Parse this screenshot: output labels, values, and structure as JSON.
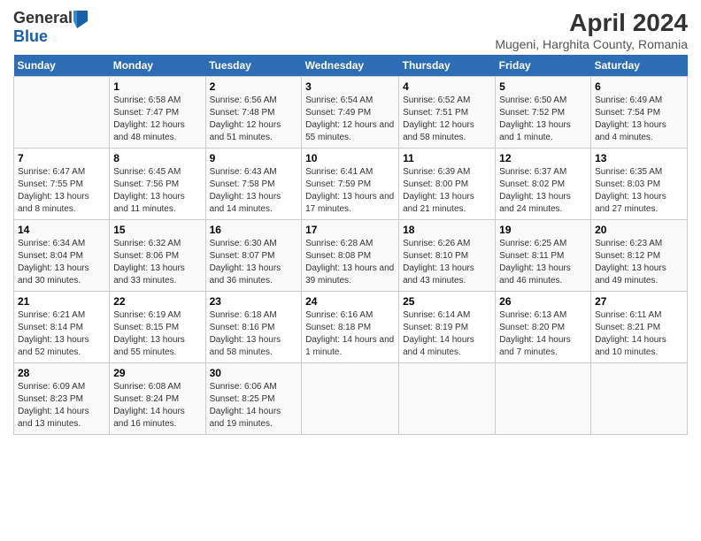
{
  "header": {
    "logo_general": "General",
    "logo_blue": "Blue",
    "title": "April 2024",
    "subtitle": "Mugeni, Harghita County, Romania"
  },
  "days_of_week": [
    "Sunday",
    "Monday",
    "Tuesday",
    "Wednesday",
    "Thursday",
    "Friday",
    "Saturday"
  ],
  "weeks": [
    [
      {
        "day": "",
        "info": ""
      },
      {
        "day": "1",
        "info": "Sunrise: 6:58 AM\nSunset: 7:47 PM\nDaylight: 12 hours\nand 48 minutes."
      },
      {
        "day": "2",
        "info": "Sunrise: 6:56 AM\nSunset: 7:48 PM\nDaylight: 12 hours\nand 51 minutes."
      },
      {
        "day": "3",
        "info": "Sunrise: 6:54 AM\nSunset: 7:49 PM\nDaylight: 12 hours\nand 55 minutes."
      },
      {
        "day": "4",
        "info": "Sunrise: 6:52 AM\nSunset: 7:51 PM\nDaylight: 12 hours\nand 58 minutes."
      },
      {
        "day": "5",
        "info": "Sunrise: 6:50 AM\nSunset: 7:52 PM\nDaylight: 13 hours\nand 1 minute."
      },
      {
        "day": "6",
        "info": "Sunrise: 6:49 AM\nSunset: 7:54 PM\nDaylight: 13 hours\nand 4 minutes."
      }
    ],
    [
      {
        "day": "7",
        "info": "Sunrise: 6:47 AM\nSunset: 7:55 PM\nDaylight: 13 hours\nand 8 minutes."
      },
      {
        "day": "8",
        "info": "Sunrise: 6:45 AM\nSunset: 7:56 PM\nDaylight: 13 hours\nand 11 minutes."
      },
      {
        "day": "9",
        "info": "Sunrise: 6:43 AM\nSunset: 7:58 PM\nDaylight: 13 hours\nand 14 minutes."
      },
      {
        "day": "10",
        "info": "Sunrise: 6:41 AM\nSunset: 7:59 PM\nDaylight: 13 hours\nand 17 minutes."
      },
      {
        "day": "11",
        "info": "Sunrise: 6:39 AM\nSunset: 8:00 PM\nDaylight: 13 hours\nand 21 minutes."
      },
      {
        "day": "12",
        "info": "Sunrise: 6:37 AM\nSunset: 8:02 PM\nDaylight: 13 hours\nand 24 minutes."
      },
      {
        "day": "13",
        "info": "Sunrise: 6:35 AM\nSunset: 8:03 PM\nDaylight: 13 hours\nand 27 minutes."
      }
    ],
    [
      {
        "day": "14",
        "info": "Sunrise: 6:34 AM\nSunset: 8:04 PM\nDaylight: 13 hours\nand 30 minutes."
      },
      {
        "day": "15",
        "info": "Sunrise: 6:32 AM\nSunset: 8:06 PM\nDaylight: 13 hours\nand 33 minutes."
      },
      {
        "day": "16",
        "info": "Sunrise: 6:30 AM\nSunset: 8:07 PM\nDaylight: 13 hours\nand 36 minutes."
      },
      {
        "day": "17",
        "info": "Sunrise: 6:28 AM\nSunset: 8:08 PM\nDaylight: 13 hours\nand 39 minutes."
      },
      {
        "day": "18",
        "info": "Sunrise: 6:26 AM\nSunset: 8:10 PM\nDaylight: 13 hours\nand 43 minutes."
      },
      {
        "day": "19",
        "info": "Sunrise: 6:25 AM\nSunset: 8:11 PM\nDaylight: 13 hours\nand 46 minutes."
      },
      {
        "day": "20",
        "info": "Sunrise: 6:23 AM\nSunset: 8:12 PM\nDaylight: 13 hours\nand 49 minutes."
      }
    ],
    [
      {
        "day": "21",
        "info": "Sunrise: 6:21 AM\nSunset: 8:14 PM\nDaylight: 13 hours\nand 52 minutes."
      },
      {
        "day": "22",
        "info": "Sunrise: 6:19 AM\nSunset: 8:15 PM\nDaylight: 13 hours\nand 55 minutes."
      },
      {
        "day": "23",
        "info": "Sunrise: 6:18 AM\nSunset: 8:16 PM\nDaylight: 13 hours\nand 58 minutes."
      },
      {
        "day": "24",
        "info": "Sunrise: 6:16 AM\nSunset: 8:18 PM\nDaylight: 14 hours\nand 1 minute."
      },
      {
        "day": "25",
        "info": "Sunrise: 6:14 AM\nSunset: 8:19 PM\nDaylight: 14 hours\nand 4 minutes."
      },
      {
        "day": "26",
        "info": "Sunrise: 6:13 AM\nSunset: 8:20 PM\nDaylight: 14 hours\nand 7 minutes."
      },
      {
        "day": "27",
        "info": "Sunrise: 6:11 AM\nSunset: 8:21 PM\nDaylight: 14 hours\nand 10 minutes."
      }
    ],
    [
      {
        "day": "28",
        "info": "Sunrise: 6:09 AM\nSunset: 8:23 PM\nDaylight: 14 hours\nand 13 minutes."
      },
      {
        "day": "29",
        "info": "Sunrise: 6:08 AM\nSunset: 8:24 PM\nDaylight: 14 hours\nand 16 minutes."
      },
      {
        "day": "30",
        "info": "Sunrise: 6:06 AM\nSunset: 8:25 PM\nDaylight: 14 hours\nand 19 minutes."
      },
      {
        "day": "",
        "info": ""
      },
      {
        "day": "",
        "info": ""
      },
      {
        "day": "",
        "info": ""
      },
      {
        "day": "",
        "info": ""
      }
    ]
  ]
}
